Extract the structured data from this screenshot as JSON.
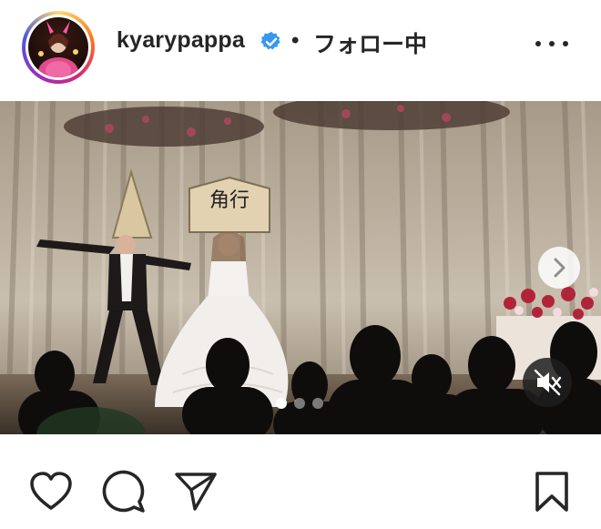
{
  "post": {
    "username": "kyarypappa",
    "separator": "•",
    "follow_status": "フォロー中",
    "is_verified": true,
    "verified_color": "#3897f0"
  },
  "media": {
    "placard_text": "角行",
    "carousel": {
      "count": 3,
      "active_index": 0
    },
    "muted": true
  },
  "icons": {
    "more": "more-options-icon",
    "next": "chevron-right-icon",
    "mute": "speaker-muted-icon",
    "like": "heart-icon",
    "comment": "comment-bubble-icon",
    "share": "paper-plane-icon",
    "save": "bookmark-icon"
  }
}
